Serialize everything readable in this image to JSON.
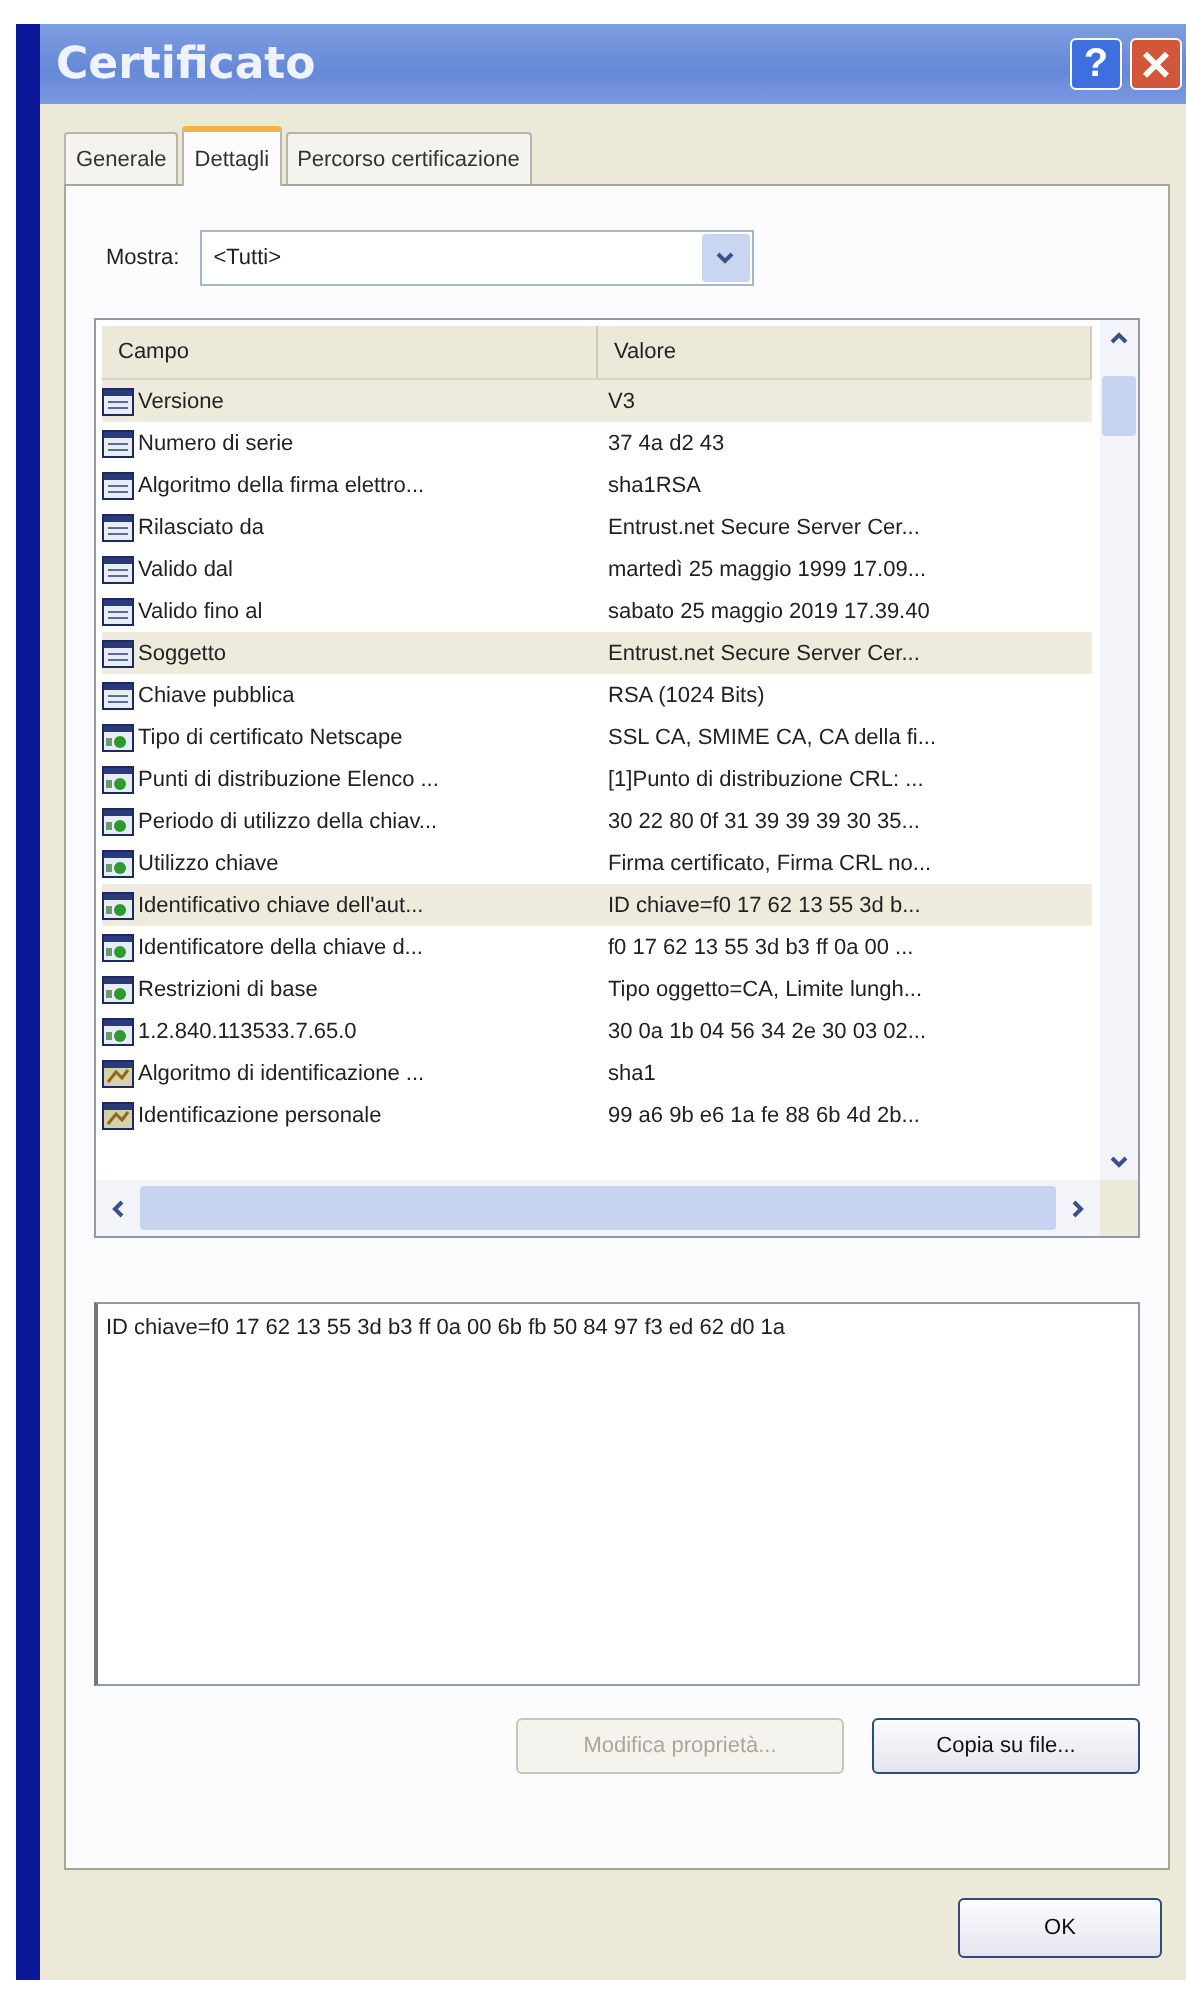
{
  "window": {
    "title": "Certificato",
    "help": "?",
    "close": "×"
  },
  "tabs": [
    {
      "label": "Generale",
      "selected": false
    },
    {
      "label": "Dettagli",
      "selected": true
    },
    {
      "label": "Percorso certificazione",
      "selected": false
    }
  ],
  "show": {
    "label": "Mostra:",
    "value": "<Tutti>"
  },
  "table": {
    "columns": [
      "Campo",
      "Valore"
    ],
    "rows": [
      {
        "kind": "field",
        "field": "Versione",
        "value": "V3",
        "selected": true
      },
      {
        "kind": "field",
        "field": "Numero di serie",
        "value": "37 4a d2 43",
        "selected": false
      },
      {
        "kind": "field",
        "field": "Algoritmo della firma elettro...",
        "value": "sha1RSA",
        "selected": false
      },
      {
        "kind": "field",
        "field": "Rilasciato da",
        "value": "Entrust.net Secure Server Cer...",
        "selected": false
      },
      {
        "kind": "field",
        "field": "Valido dal",
        "value": "martedì 25 maggio 1999 17.09...",
        "selected": false
      },
      {
        "kind": "field",
        "field": "Valido fino al",
        "value": "sabato 25 maggio 2019 17.39.40",
        "selected": false
      },
      {
        "kind": "field",
        "field": "Soggetto",
        "value": "Entrust.net Secure Server Cer...",
        "selected": true
      },
      {
        "kind": "field",
        "field": "Chiave pubblica",
        "value": "RSA (1024 Bits)",
        "selected": false
      },
      {
        "kind": "extension",
        "field": "Tipo di certificato Netscape",
        "value": "SSL CA, SMIME CA, CA della fi...",
        "selected": false
      },
      {
        "kind": "extension",
        "field": "Punti di distribuzione Elenco ...",
        "value": "[1]Punto di distribuzione CRL: ...",
        "selected": false
      },
      {
        "kind": "extension",
        "field": "Periodo di utilizzo della chiav...",
        "value": "30 22 80 0f 31 39 39 39 30 35...",
        "selected": false
      },
      {
        "kind": "extension",
        "field": "Utilizzo chiave",
        "value": "Firma certificato, Firma CRL no...",
        "selected": false
      },
      {
        "kind": "extension",
        "field": "Identificativo chiave dell'aut...",
        "value": "ID chiave=f0 17 62 13 55 3d b...",
        "selected": true
      },
      {
        "kind": "extension",
        "field": "Identificatore della chiave d...",
        "value": "f0 17 62 13 55 3d b3 ff 0a 00 ...",
        "selected": false
      },
      {
        "kind": "extension",
        "field": "Restrizioni di base",
        "value": "Tipo oggetto=CA, Limite lungh...",
        "selected": false
      },
      {
        "kind": "extension",
        "field": "1.2.840.113533.7.65.0",
        "value": "30 0a 1b 04 56 34 2e 30 03 02...",
        "selected": false
      },
      {
        "kind": "property",
        "field": "Algoritmo di identificazione ...",
        "value": "sha1",
        "selected": false
      },
      {
        "kind": "property",
        "field": "Identificazione personale",
        "value": "99 a6 9b e6 1a fe 88 6b 4d 2b...",
        "selected": false
      }
    ]
  },
  "detail": "ID chiave=f0 17 62 13 55 3d b3 ff 0a 00 6b fb 50 84 97 f3 ed 62 d0 1a",
  "buttons": [
    {
      "label": "Modifica proprietà...",
      "disabled": true
    },
    {
      "label": "Copia su file...",
      "disabled": false
    }
  ],
  "ok": "OK"
}
